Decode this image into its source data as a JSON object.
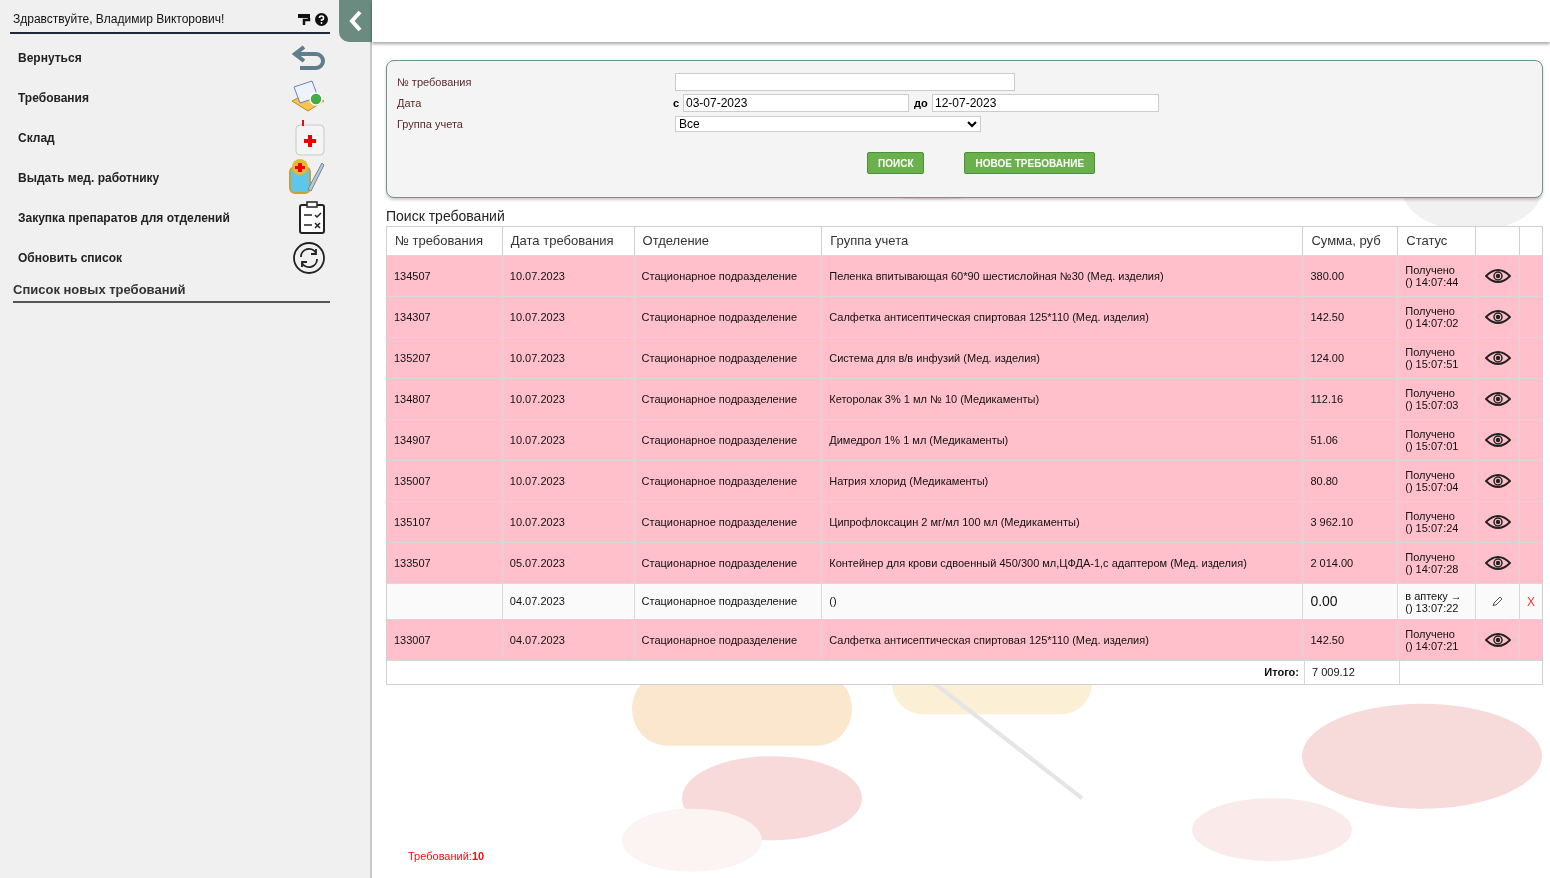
{
  "sidebar": {
    "greeting": "Здравствуйте, Владимир Викторович!",
    "items": [
      {
        "label": "Вернуться",
        "kind": "back"
      },
      {
        "label": "Требования",
        "kind": "mail"
      },
      {
        "label": "Склад",
        "kind": "kit"
      },
      {
        "label": "Выдать мед. работнику",
        "kind": "syringe"
      },
      {
        "label": "Закупка препаратов для отделений",
        "kind": "clipboard"
      },
      {
        "label": "Обновить список",
        "kind": "refresh"
      }
    ],
    "section_title": "Список новых требований"
  },
  "filter": {
    "number_label": "№ требования",
    "date_label": "Дата",
    "from_label": "с",
    "from_value": "03-07-2023",
    "to_label": "до",
    "to_value": "12-07-2023",
    "group_label": "Группа учета",
    "group_value": "Все",
    "buttons": [
      "ПОИСК",
      "НОВОЕ ТРЕБОВАНИЕ"
    ]
  },
  "table": {
    "title": "Поиск требований",
    "columns": [
      "№ требования",
      "Дата требования",
      "Отделение",
      "Группа учета",
      "Сумма, руб",
      "Статус"
    ],
    "rows": [
      {
        "kind": "received",
        "number": "134507",
        "date": "10.07.2023",
        "department": "Стационарное подразделение",
        "group": "Пеленка впитывающая 60*90 шестислойная №30 (Мед. изделия)",
        "sum": "380.00",
        "status": "Получено",
        "time": "() 14:07:44"
      },
      {
        "kind": "received",
        "number": "134307",
        "date": "10.07.2023",
        "department": "Стационарное подразделение",
        "group": "Салфетка антисептическая спиртовая 125*110 (Мед. изделия)",
        "sum": "142.50",
        "status": "Получено",
        "time": "() 14:07:02"
      },
      {
        "kind": "received",
        "number": "135207",
        "date": "10.07.2023",
        "department": "Стационарное подразделение",
        "group": "Система для в/в инфузий (Мед. изделия)",
        "sum": "124.00",
        "status": "Получено",
        "time": "() 15:07:51"
      },
      {
        "kind": "received",
        "number": "134807",
        "date": "10.07.2023",
        "department": "Стационарное подразделение",
        "group": "Кеторолак 3% 1 мл № 10 (Медикаменты)",
        "sum": "112.16",
        "status": "Получено",
        "time": "() 15:07:03"
      },
      {
        "kind": "received",
        "number": "134907",
        "date": "10.07.2023",
        "department": "Стационарное подразделение",
        "group": "Димедрол 1% 1 мл (Медикаменты)",
        "sum": "51.06",
        "status": "Получено",
        "time": "() 15:07:01"
      },
      {
        "kind": "received",
        "number": "135007",
        "date": "10.07.2023",
        "department": "Стационарное подразделение",
        "group": "Натрия хлорид (Медикаменты)",
        "sum": "80.80",
        "status": "Получено",
        "time": "() 15:07:04"
      },
      {
        "kind": "received",
        "number": "135107",
        "date": "10.07.2023",
        "department": "Стационарное подразделение",
        "group": "Ципрофлоксацин 2 мг/мл 100 мл (Медикаменты)",
        "sum": "3 962.10",
        "status": "Получено",
        "time": "() 15:07:24"
      },
      {
        "kind": "received",
        "number": "133507",
        "date": "05.07.2023",
        "department": "Стационарное подразделение",
        "group": "Контейнер для крови сдвоенный 450/300 мл,ЦФДА-1,с адаптером (Мед. изделия)",
        "sum": "2 014.00",
        "status": "Получено",
        "time": "() 14:07:28"
      },
      {
        "kind": "draft",
        "date": "04.07.2023",
        "department": "Стационарное подразделение",
        "group": "()",
        "sum": "0.00",
        "status": "в аптеку →",
        "time": "() 13:07:22",
        "delete": "X"
      },
      {
        "kind": "received",
        "number": "133007",
        "date": "04.07.2023",
        "department": "Стационарное подразделение",
        "group": "Салфетка антисептическая спиртовая 125*110 (Мед. изделия)",
        "sum": "142.50",
        "status": "Получено",
        "time": "() 14:07:21"
      }
    ],
    "total_label": "Итого:",
    "total": "7 009.12"
  },
  "footer_count": "Требований:**10**"
}
